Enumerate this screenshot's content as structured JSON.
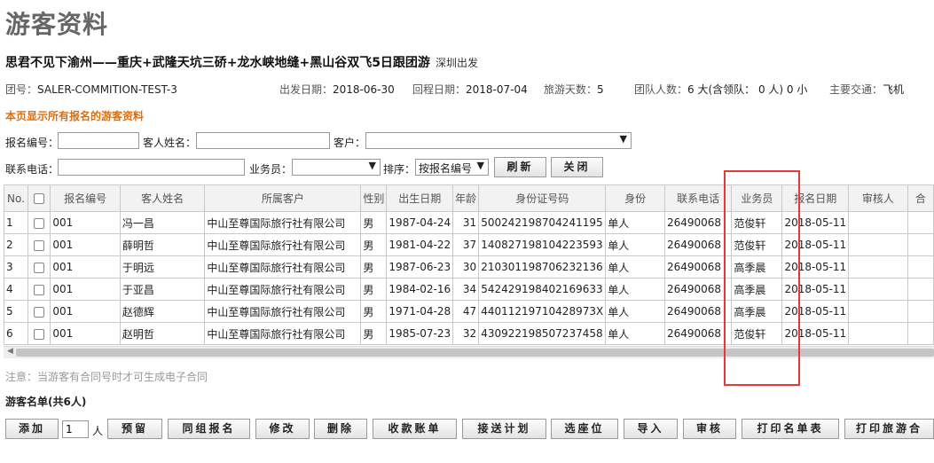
{
  "page": {
    "title": "游客资料"
  },
  "tour": {
    "title": "思君不见下渝州——重庆+武隆天坑三硚+龙水峡地缝+黑山谷双飞5日跟团游",
    "departure": "深圳出发"
  },
  "info": {
    "group_label": "团号：",
    "group_value": "SALER-COMMITION-TEST-3",
    "depart_label": "出发日期：",
    "depart_value": "2018-06-30",
    "return_label": "回程日期：",
    "return_value": "2018-07-04",
    "days_label": "旅游天数：",
    "days_value": "5",
    "size_label": "团队人数：",
    "size_value": "6 大(含领队： 0 人) 0 小",
    "transport_label": "主要交通：",
    "transport_value": "飞机"
  },
  "notice": "本页显示所有报名的游客资料",
  "filters": {
    "reg_no_label": "报名编号：",
    "name_label": "客人姓名：",
    "customer_label": "客户：",
    "phone_label": "联系电话：",
    "salesman_label": "业务员：",
    "sort_label": "排序：",
    "sort_value": "按报名编号",
    "refresh_label": "刷新",
    "close_label": "关闭"
  },
  "table": {
    "headers": [
      "No.",
      "",
      "报名编号",
      "客人姓名",
      "所属客户",
      "性别",
      "出生日期",
      "年龄",
      "身份证号码",
      "身份",
      "联系电话",
      "业务员",
      "报名日期",
      "审核人",
      "合"
    ],
    "rows": [
      {
        "no": "1",
        "reg": "001",
        "name": "冯一昌",
        "customer": "中山至尊国际旅行社有限公司",
        "gender": "男",
        "birth": "1987-04-24",
        "age": "31",
        "id": "500242198704241195",
        "role": "单人",
        "phone": "26490068",
        "salesman": "范俊轩",
        "date": "2018-05-11"
      },
      {
        "no": "2",
        "reg": "001",
        "name": "薛明哲",
        "customer": "中山至尊国际旅行社有限公司",
        "gender": "男",
        "birth": "1981-04-22",
        "age": "37",
        "id": "140827198104223593",
        "role": "单人",
        "phone": "26490068",
        "salesman": "范俊轩",
        "date": "2018-05-11"
      },
      {
        "no": "3",
        "reg": "001",
        "name": "于明远",
        "customer": "中山至尊国际旅行社有限公司",
        "gender": "男",
        "birth": "1987-06-23",
        "age": "30",
        "id": "210301198706232136",
        "role": "单人",
        "phone": "26490068",
        "salesman": "高季晨",
        "date": "2018-05-11"
      },
      {
        "no": "4",
        "reg": "001",
        "name": "于亚昌",
        "customer": "中山至尊国际旅行社有限公司",
        "gender": "男",
        "birth": "1984-02-16",
        "age": "34",
        "id": "542429198402169633",
        "role": "单人",
        "phone": "26490068",
        "salesman": "高季晨",
        "date": "2018-05-11"
      },
      {
        "no": "5",
        "reg": "001",
        "name": "赵德辉",
        "customer": "中山至尊国际旅行社有限公司",
        "gender": "男",
        "birth": "1971-04-28",
        "age": "47",
        "id": "44011219710428973X",
        "role": "单人",
        "phone": "26490068",
        "salesman": "高季晨",
        "date": "2018-05-11"
      },
      {
        "no": "6",
        "reg": "001",
        "name": "赵明哲",
        "customer": "中山至尊国际旅行社有限公司",
        "gender": "男",
        "birth": "1985-07-23",
        "age": "32",
        "id": "430922198507237458",
        "role": "单人",
        "phone": "26490068",
        "salesman": "范俊轩",
        "date": "2018-05-11"
      }
    ]
  },
  "note": "注意：当游客有合同号时才可生成电子合同",
  "list_title": "游客名单(共6人)",
  "toolbar": {
    "add": "添加",
    "count": "1",
    "unit": "人",
    "reserve": "预留",
    "group_reg": "同组报名",
    "edit": "修改",
    "delete": "删除",
    "payment": "收款账单",
    "transfer": "接送计划",
    "seat": "选座位",
    "import": "导入",
    "review": "审核",
    "print_list": "打印名单表",
    "print_contract": "打印旅游合"
  },
  "colors": {
    "highlight_box": "#e53935",
    "notice": "#e06d0b"
  }
}
